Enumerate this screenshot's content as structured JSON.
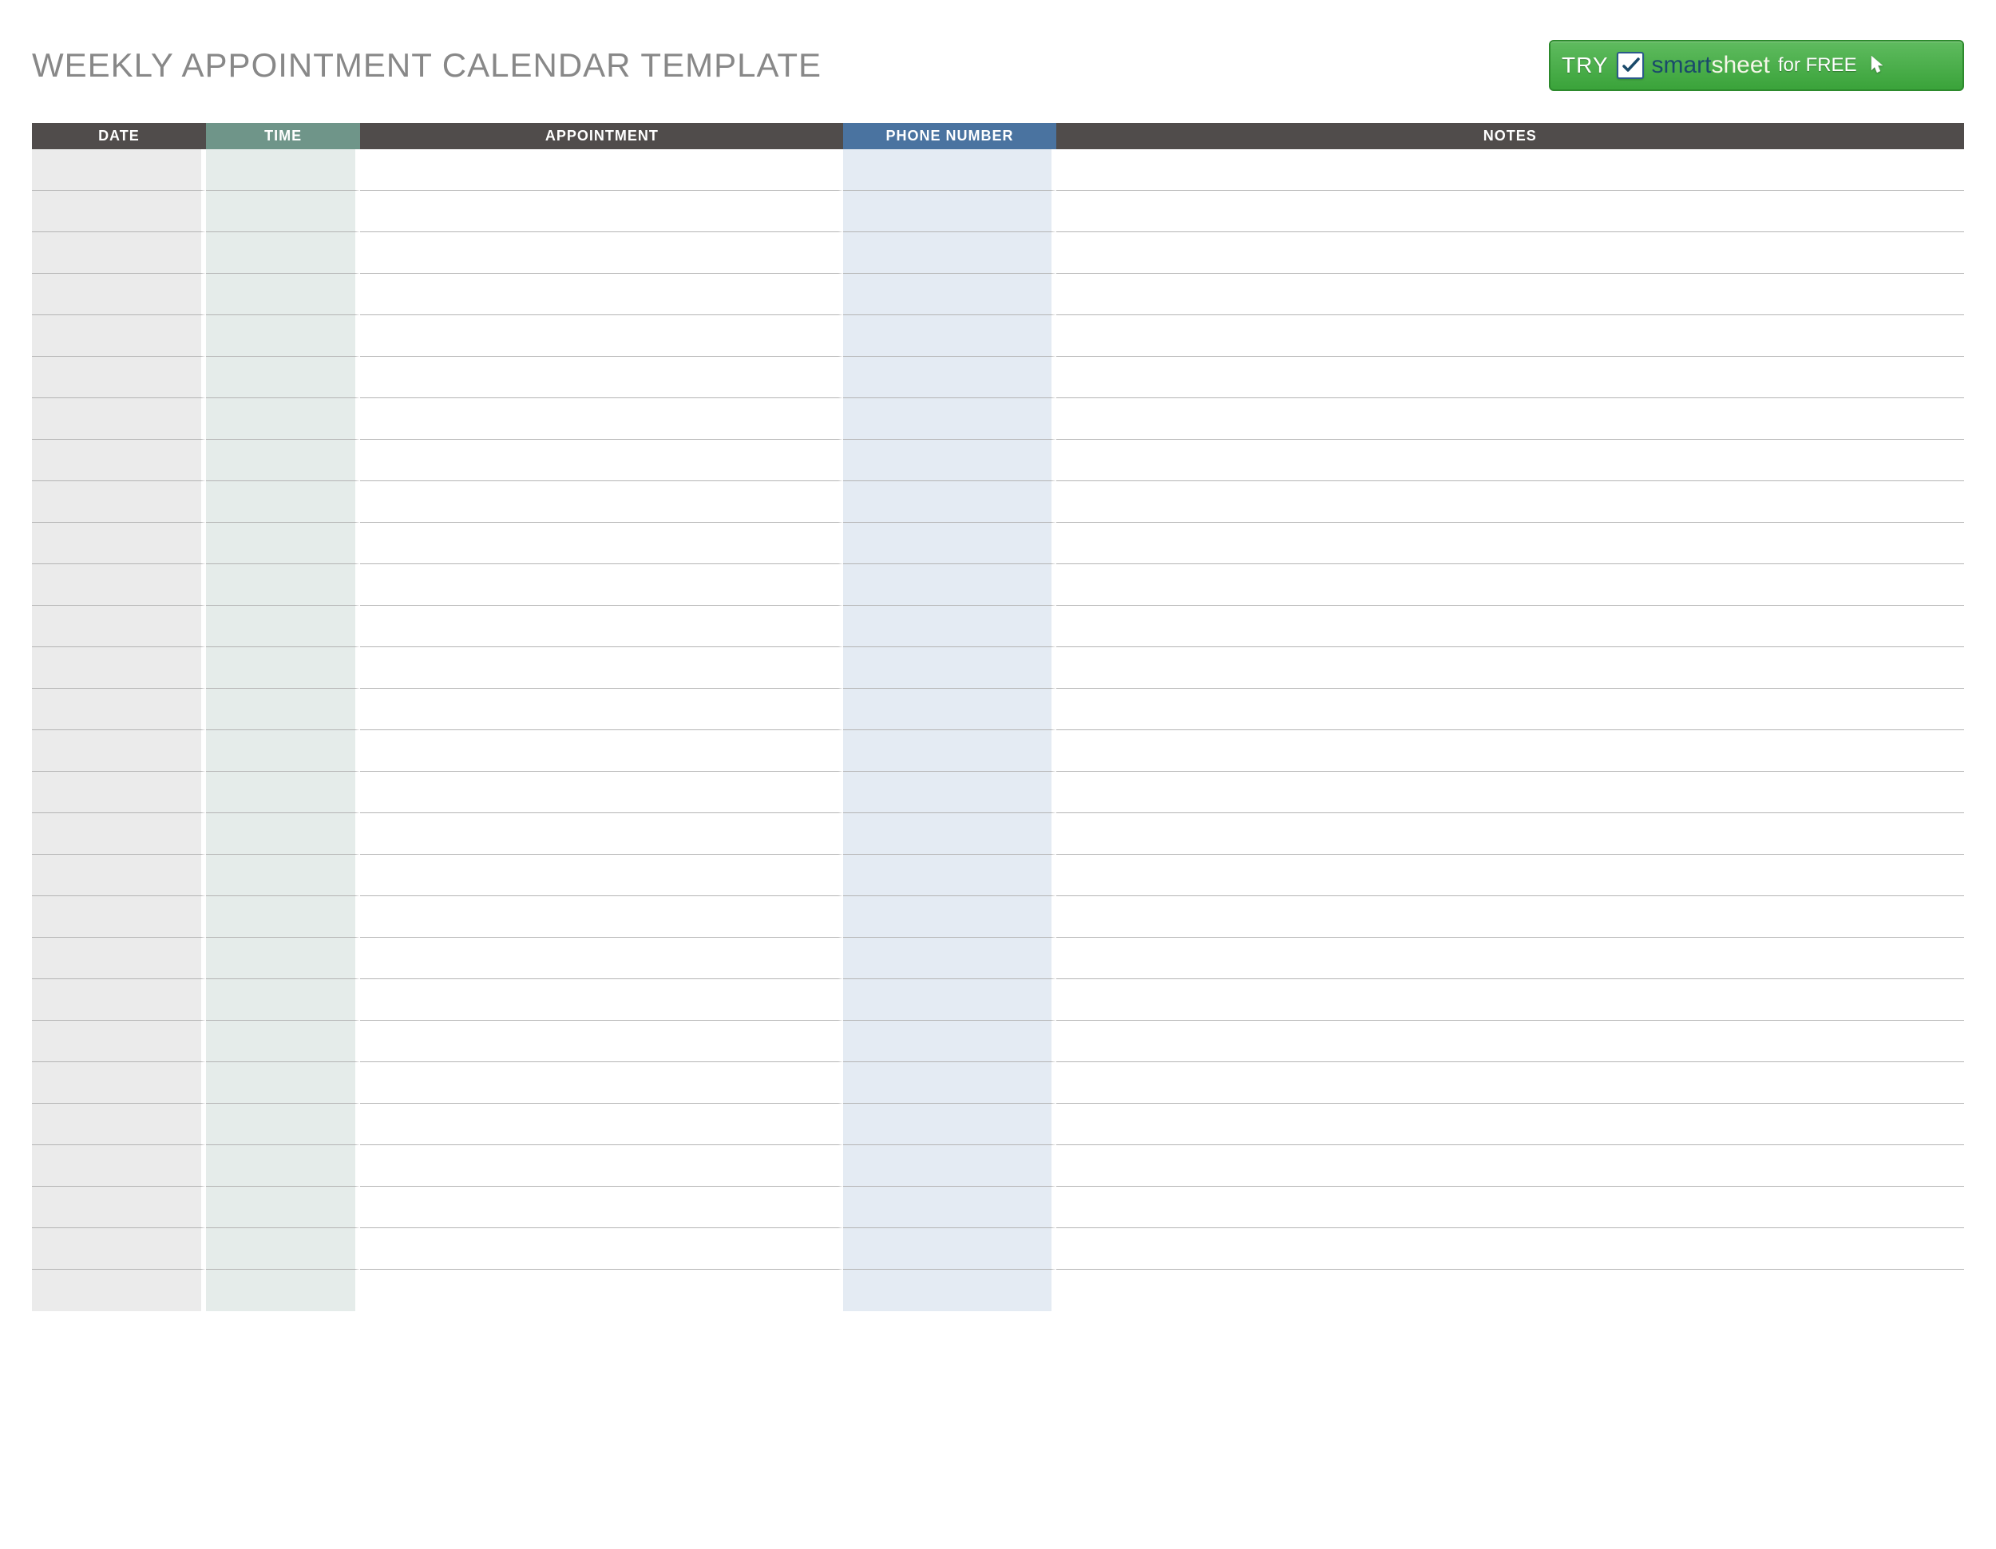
{
  "title": "WEEKLY APPOINTMENT CALENDAR TEMPLATE",
  "promo": {
    "try": "TRY",
    "logo_smart": "smart",
    "logo_sheet": "sheet",
    "for_free": "for FREE"
  },
  "columns": {
    "date": "DATE",
    "time": "TIME",
    "appointment": "APPOINTMENT",
    "phone": "PHONE NUMBER",
    "notes": "NOTES"
  },
  "rows": [
    {
      "date": "",
      "time": "",
      "appointment": "",
      "phone": "",
      "notes": ""
    },
    {
      "date": "",
      "time": "",
      "appointment": "",
      "phone": "",
      "notes": ""
    },
    {
      "date": "",
      "time": "",
      "appointment": "",
      "phone": "",
      "notes": ""
    },
    {
      "date": "",
      "time": "",
      "appointment": "",
      "phone": "",
      "notes": ""
    },
    {
      "date": "",
      "time": "",
      "appointment": "",
      "phone": "",
      "notes": ""
    },
    {
      "date": "",
      "time": "",
      "appointment": "",
      "phone": "",
      "notes": ""
    },
    {
      "date": "",
      "time": "",
      "appointment": "",
      "phone": "",
      "notes": ""
    },
    {
      "date": "",
      "time": "",
      "appointment": "",
      "phone": "",
      "notes": ""
    },
    {
      "date": "",
      "time": "",
      "appointment": "",
      "phone": "",
      "notes": ""
    },
    {
      "date": "",
      "time": "",
      "appointment": "",
      "phone": "",
      "notes": ""
    },
    {
      "date": "",
      "time": "",
      "appointment": "",
      "phone": "",
      "notes": ""
    },
    {
      "date": "",
      "time": "",
      "appointment": "",
      "phone": "",
      "notes": ""
    },
    {
      "date": "",
      "time": "",
      "appointment": "",
      "phone": "",
      "notes": ""
    },
    {
      "date": "",
      "time": "",
      "appointment": "",
      "phone": "",
      "notes": ""
    },
    {
      "date": "",
      "time": "",
      "appointment": "",
      "phone": "",
      "notes": ""
    },
    {
      "date": "",
      "time": "",
      "appointment": "",
      "phone": "",
      "notes": ""
    },
    {
      "date": "",
      "time": "",
      "appointment": "",
      "phone": "",
      "notes": ""
    },
    {
      "date": "",
      "time": "",
      "appointment": "",
      "phone": "",
      "notes": ""
    },
    {
      "date": "",
      "time": "",
      "appointment": "",
      "phone": "",
      "notes": ""
    },
    {
      "date": "",
      "time": "",
      "appointment": "",
      "phone": "",
      "notes": ""
    },
    {
      "date": "",
      "time": "",
      "appointment": "",
      "phone": "",
      "notes": ""
    },
    {
      "date": "",
      "time": "",
      "appointment": "",
      "phone": "",
      "notes": ""
    },
    {
      "date": "",
      "time": "",
      "appointment": "",
      "phone": "",
      "notes": ""
    },
    {
      "date": "",
      "time": "",
      "appointment": "",
      "phone": "",
      "notes": ""
    },
    {
      "date": "",
      "time": "",
      "appointment": "",
      "phone": "",
      "notes": ""
    },
    {
      "date": "",
      "time": "",
      "appointment": "",
      "phone": "",
      "notes": ""
    },
    {
      "date": "",
      "time": "",
      "appointment": "",
      "phone": "",
      "notes": ""
    },
    {
      "date": "",
      "time": "",
      "appointment": "",
      "phone": "",
      "notes": ""
    }
  ]
}
